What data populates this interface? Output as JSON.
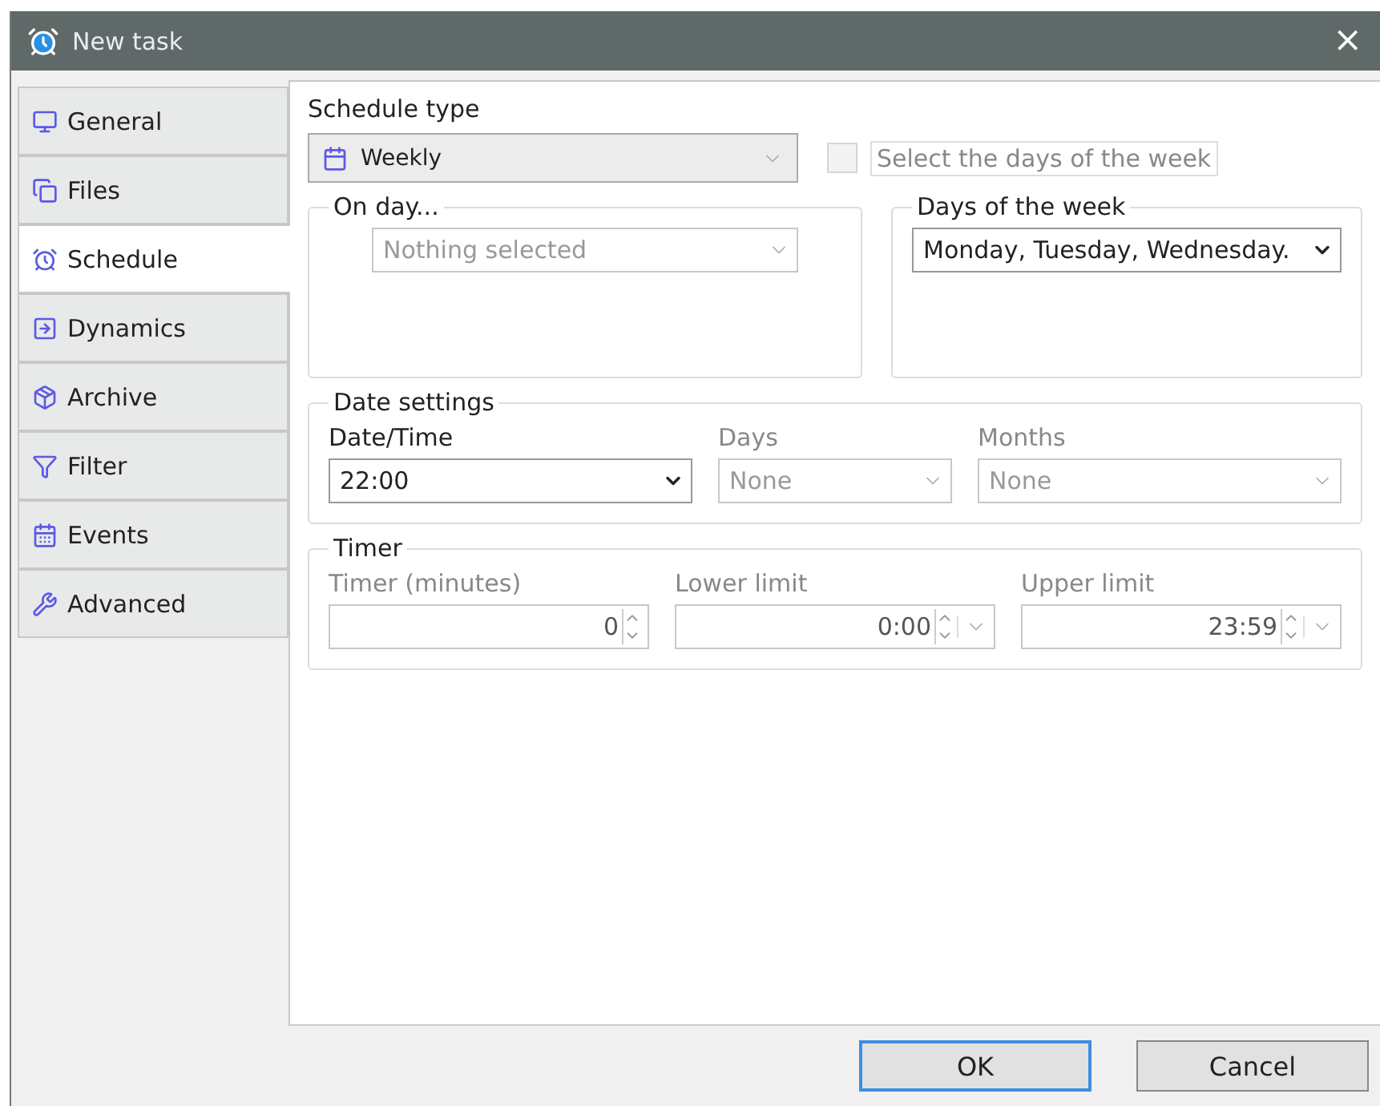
{
  "window": {
    "title": "New task",
    "close": "×"
  },
  "tabs": [
    {
      "label": "General",
      "selected": false
    },
    {
      "label": "Files",
      "selected": false
    },
    {
      "label": "Schedule",
      "selected": true
    },
    {
      "label": "Dynamics",
      "selected": false
    },
    {
      "label": "Archive",
      "selected": false
    },
    {
      "label": "Filter",
      "selected": false
    },
    {
      "label": "Events",
      "selected": false
    },
    {
      "label": "Advanced",
      "selected": false
    }
  ],
  "schedule_type": {
    "label": "Schedule type",
    "value": "Weekly"
  },
  "select_days_checkbox": {
    "label": "Select the days of the week",
    "checked": false,
    "disabled": true
  },
  "on_day": {
    "title": "On day...",
    "value": "Nothing selected",
    "disabled": true
  },
  "days_of_week": {
    "title": "Days of the week",
    "value": "Monday, Tuesday, Wednesday.",
    "disabled": false
  },
  "date_settings": {
    "title": "Date settings",
    "fields": [
      {
        "label": "Date/Time",
        "value": "22:00",
        "disabled": false
      },
      {
        "label": "Days",
        "value": "None",
        "disabled": true
      },
      {
        "label": "Months",
        "value": "None",
        "disabled": true
      }
    ]
  },
  "timer": {
    "title": "Timer",
    "fields": [
      {
        "label": "Timer (minutes)",
        "value": "0",
        "dropdown": false,
        "disabled": true
      },
      {
        "label": "Lower limit",
        "value": "0:00",
        "dropdown": true,
        "disabled": true
      },
      {
        "label": "Upper limit",
        "value": "23:59",
        "dropdown": true,
        "disabled": true
      }
    ]
  },
  "buttons": [
    {
      "label": "OK",
      "default": true
    },
    {
      "label": "Cancel",
      "default": false
    }
  ]
}
